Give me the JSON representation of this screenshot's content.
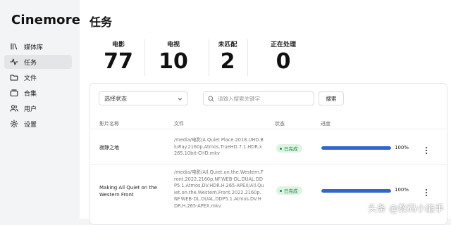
{
  "app": {
    "brand": "Cinemore"
  },
  "sidebar": {
    "items": [
      {
        "label": "媒体库",
        "icon": "library-icon",
        "active": false
      },
      {
        "label": "任务",
        "icon": "activity-icon",
        "active": true
      },
      {
        "label": "文件",
        "icon": "folder-icon",
        "active": false
      },
      {
        "label": "合集",
        "icon": "collection-icon",
        "active": false
      },
      {
        "label": "用户",
        "icon": "users-icon",
        "active": false
      },
      {
        "label": "设置",
        "icon": "gear-icon",
        "active": false
      }
    ]
  },
  "page": {
    "title": "任务"
  },
  "stats": [
    {
      "label": "电影",
      "value": "77"
    },
    {
      "label": "电视",
      "value": "10"
    },
    {
      "label": "未匹配",
      "value": "2"
    },
    {
      "label": "正在处理",
      "value": "0"
    }
  ],
  "filters": {
    "status_select": "选择状态",
    "search_placeholder": "请输入搜索关键字",
    "search_button": "搜索"
  },
  "table": {
    "headers": [
      "影片名称",
      "文件",
      "状态",
      "进度"
    ],
    "rows": [
      {
        "title": "寂静之地",
        "file": "/media/电影/A Quiet Place.2018.UHD.BluRay.2160p.Atmos.TrueHD.7.1.HDR.x265.10bit-CHD.mkv",
        "status": "已完成",
        "progress": 100,
        "progress_text": "100%"
      },
      {
        "title": "Making All Quiet on the Western Front",
        "file": "/media/电影/All.Quiet.on.the.Western.Front.2022.2160p.NF.WEB-DL.DUAL.DDP5.1.Atmos.DV.HDR.H.265-APEX/All.Quiet.on.the.Western.Front.2022.2160p.NF.WEB-DL.DUAL.DDP5.1.Atmos.DV.HDR.H.265-APEX.mkv",
        "status": "已完成",
        "progress": 100,
        "progress_text": "100%"
      }
    ]
  },
  "colors": {
    "progress": "#3366cc",
    "status_done": "#1c8a3e",
    "status_done_bg": "#dff3e4"
  },
  "watermark": "头条 @数码小能手"
}
